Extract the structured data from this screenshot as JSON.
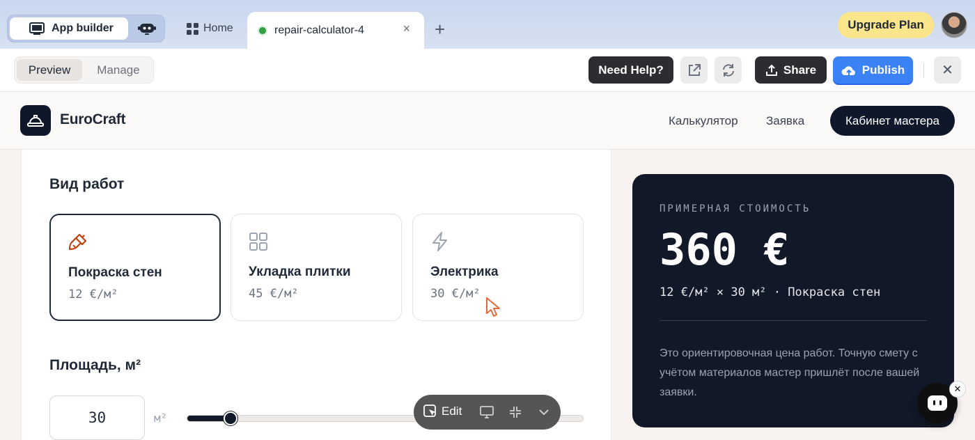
{
  "tabbar": {
    "app_builder_label": "App builder",
    "home_label": "Home",
    "active_tab_label": "repair-calculator-4",
    "close_glyph": "×",
    "new_tab_glyph": "+",
    "upgrade_label": "Upgrade Plan"
  },
  "toolbar": {
    "preview_label": "Preview",
    "manage_label": "Manage",
    "help_label": "Need Help?",
    "share_label": "Share",
    "publish_label": "Publish",
    "close_glyph": "✕",
    "publish_color": "#3b82f6"
  },
  "app": {
    "brand": "EuroCraft",
    "nav": [
      "Калькулятор",
      "Заявка"
    ],
    "cabinet_label": "Кабинет мастера",
    "accent": "#0f172a"
  },
  "calculator": {
    "work_title": "Вид работ",
    "work_types": [
      {
        "name": "Покраска стен",
        "price": "12 €/м²",
        "icon": "paint-brush-icon",
        "selected": true
      },
      {
        "name": "Укладка плитки",
        "price": "45 €/м²",
        "icon": "grid-icon",
        "selected": false
      },
      {
        "name": "Электрика",
        "price": "30 €/м²",
        "icon": "lightning-icon",
        "selected": false
      }
    ],
    "area_title": "Площадь, м²",
    "area_value": "30",
    "area_unit": "м²",
    "slider_fraction": 0.11
  },
  "estimate": {
    "label": "ПРИМЕРНАЯ СТОИМОСТЬ",
    "value": "360 €",
    "formula": "12 €/м² × 30 м² · Покраска стен",
    "note": "Это ориентировочная цена работ. Точную смету с учётом материалов мастер пришлёт после вашей заявки."
  },
  "floating": {
    "edit_label": "Edit",
    "chat_close_glyph": "✕"
  }
}
